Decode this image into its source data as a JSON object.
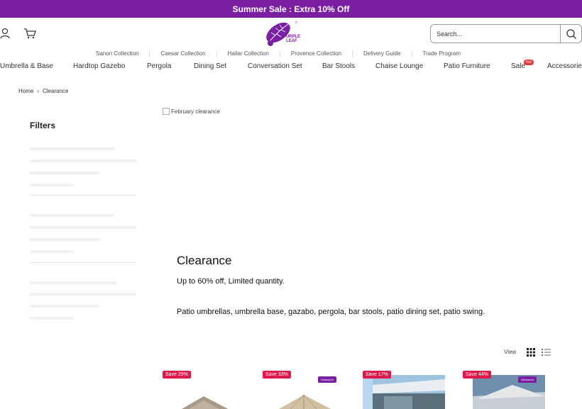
{
  "promo": {
    "text": "Summer Sale : Extra 10% Off"
  },
  "brand": {
    "color": "#7b1fa2",
    "logo_line1": "PURPLE",
    "logo_line2": "LEAF"
  },
  "header": {
    "user_icon": "user-icon",
    "cart_icon": "cart-icon"
  },
  "search": {
    "placeholder": "Search...",
    "icon": "search-icon"
  },
  "subnav": [
    "Sanori Collection",
    "Caesar Collection",
    "Hailar Collection",
    "Provence Collection",
    "Delivery Guide",
    "Trade Program"
  ],
  "mainnav": [
    "Umbrella & Base",
    "Hardtop Gazebo",
    "Pergola",
    "Dining Set",
    "Conversation Set",
    "Bar Stools",
    "Chaise Lounge",
    "Patio Furniture",
    "Sale",
    "Accessories"
  ],
  "hot_badge": "Hot",
  "breadcrumb": {
    "home": "Home",
    "separator": "›",
    "current": "Clearance"
  },
  "filters": {
    "title": "Filters"
  },
  "banner": {
    "alt": "February clearance"
  },
  "page": {
    "heading": "Clearance",
    "subheading": "Up to 60% off, Limited quantity.",
    "description": "Patio umbrellas, umbrella base, gazabo, pergola, bar stools, patio dining set, patio swing."
  },
  "view": {
    "label": "View",
    "grid_icon": "grid-view-icon",
    "list_icon": "list-view-icon"
  },
  "products": [
    {
      "badge": "Save 29%",
      "clearance": ""
    },
    {
      "badge": "Save 33%",
      "clearance": "Clearance"
    },
    {
      "badge": "Save 17%",
      "clearance": ""
    },
    {
      "badge": "Save 44%",
      "clearance": "Clearance"
    }
  ]
}
